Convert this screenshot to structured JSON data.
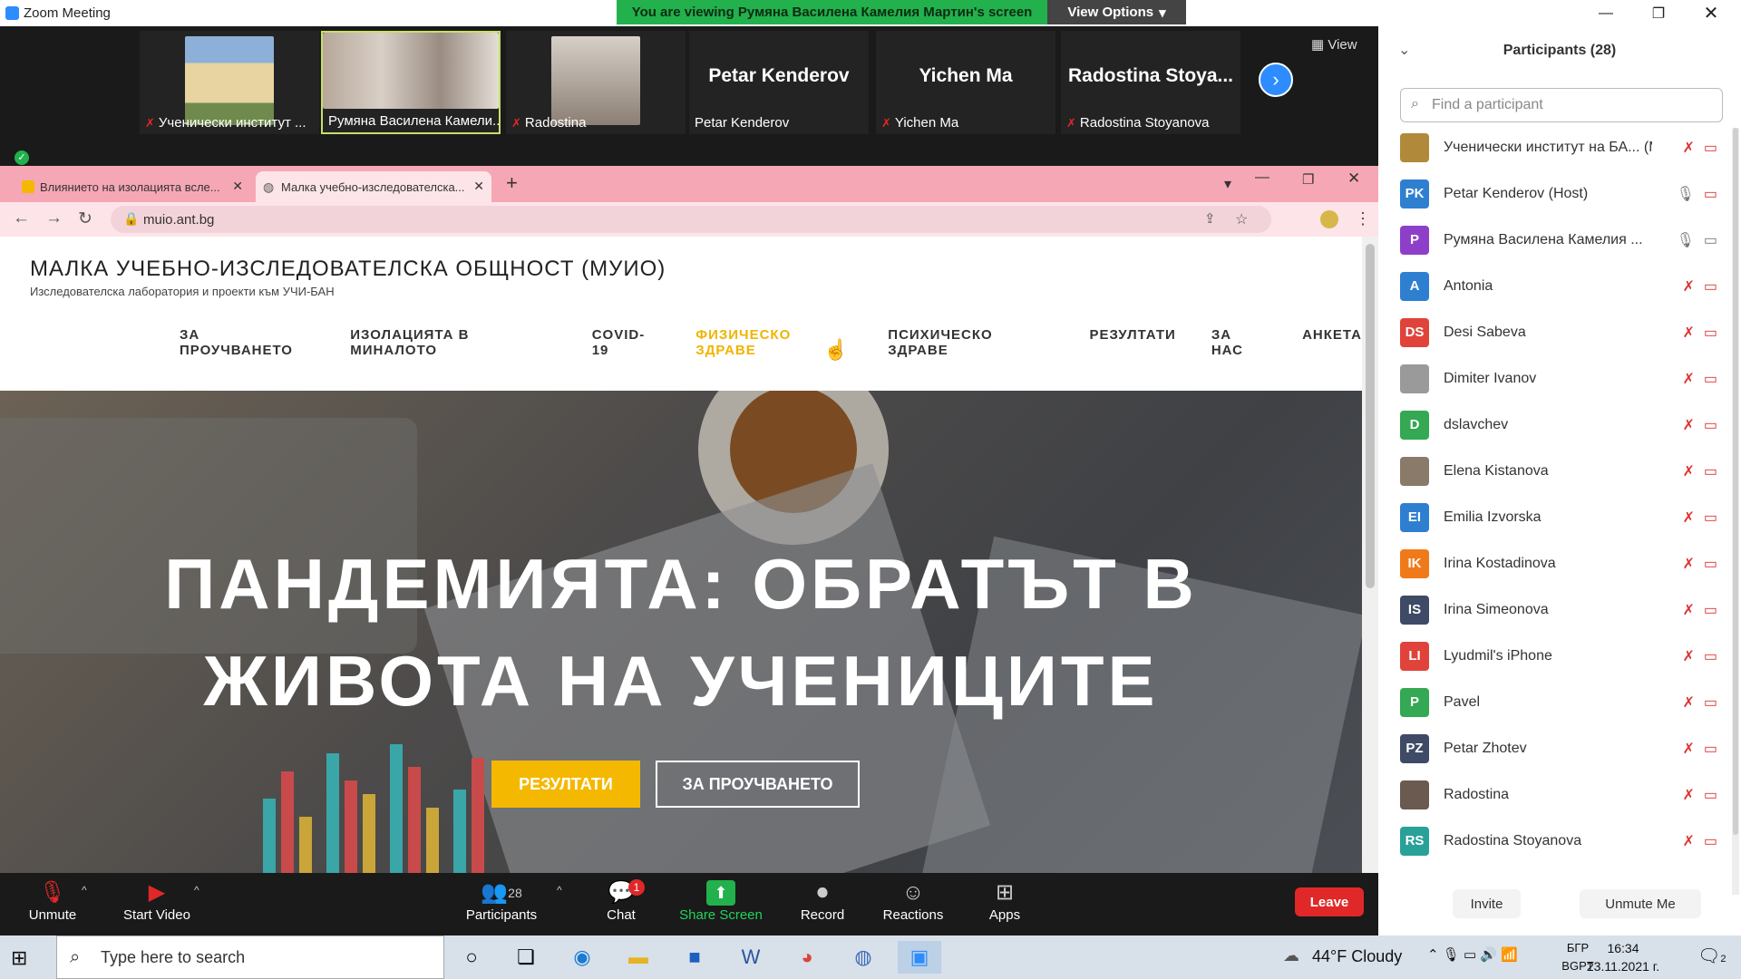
{
  "window": {
    "title": "Zoom Meeting",
    "share_banner": "You are viewing Румяна Василена Камелия Мартин's screen",
    "view_options": "View Options"
  },
  "videostrip": {
    "tiles": [
      {
        "name": "Ученически институт ...",
        "big": ""
      },
      {
        "name": "Румяна Василена Камели...",
        "big": ""
      },
      {
        "name": "Radostina",
        "big": ""
      },
      {
        "name": "Petar Kenderov",
        "big": "Petar Kenderov"
      },
      {
        "name": "Yichen Ma",
        "big": "Yichen Ma"
      },
      {
        "name": "Radostina Stoyanova",
        "big": "Radostina Stoya..."
      }
    ],
    "view_label": "View"
  },
  "browser": {
    "tabs": [
      {
        "label": "Влиянието на изолацията всле..."
      },
      {
        "label": "Малка учебно-изследователска..."
      }
    ],
    "url": "muio.ant.bg"
  },
  "site": {
    "title": "МАЛКА УЧЕБНО-ИЗСЛЕДОВАТЕЛСКА ОБЩНОСТ (МУИО)",
    "subtitle": "Изследователска лаборатория и проекти към УЧИ-БАН",
    "menu": [
      "ЗА ПРОУЧВАНЕТО",
      "ИЗОЛАЦИЯТА В МИНАЛОТО",
      "COVID-19",
      "ФИЗИЧЕСКО ЗДРАВЕ",
      "ПСИХИЧЕСКО ЗДРАВЕ",
      "РЕЗУЛТАТИ",
      "ЗА НАС",
      "АНКЕТА"
    ],
    "hero_line1": "ПАНДЕМИЯТА: ОБРАТЪТ В",
    "hero_line2": "ЖИВОТА НА УЧЕНИЦИТЕ",
    "btn_results": "РЕЗУЛТАТИ",
    "btn_about": "ЗА ПРОУЧВАНЕТО"
  },
  "participants": {
    "title": "Participants (28)",
    "search_placeholder": "Find a participant",
    "list": [
      {
        "initials": "",
        "name": "Ученически институт на БА... (Me)",
        "color": "#b08a3a"
      },
      {
        "initials": "PK",
        "name": "Petar Kenderov (Host)",
        "color": "#2f7fd1"
      },
      {
        "initials": "P",
        "name": "Румяна Василена Камелия ...",
        "color": "#8e3fc9"
      },
      {
        "initials": "A",
        "name": "Antonia",
        "color": "#2f7fd1"
      },
      {
        "initials": "DS",
        "name": "Desi Sabeva",
        "color": "#e0433a"
      },
      {
        "initials": "",
        "name": "Dimiter Ivanov",
        "color": "#9a9a9a"
      },
      {
        "initials": "D",
        "name": "dslavchev",
        "color": "#34a853"
      },
      {
        "initials": "",
        "name": "Elena Kistanova",
        "color": "#8a7a6a"
      },
      {
        "initials": "EI",
        "name": "Emilia Izvorska",
        "color": "#2f7fd1"
      },
      {
        "initials": "IK",
        "name": "Irina Kostadinova",
        "color": "#f07a1a"
      },
      {
        "initials": "IS",
        "name": "Irina Simeonova",
        "color": "#3e4a66"
      },
      {
        "initials": "LI",
        "name": "Lyudmil's iPhone",
        "color": "#e0433a"
      },
      {
        "initials": "P",
        "name": "Pavel",
        "color": "#34a853"
      },
      {
        "initials": "PZ",
        "name": "Petar Zhotev",
        "color": "#3e4a66"
      },
      {
        "initials": "",
        "name": "Radostina",
        "color": "#6a5a50"
      },
      {
        "initials": "RS",
        "name": "Radostina Stoyanova",
        "color": "#2aa198"
      }
    ],
    "invite": "Invite",
    "unmute_me": "Unmute Me"
  },
  "toolbar": {
    "unmute": "Unmute",
    "start_video": "Start Video",
    "participants": "Participants",
    "participants_count": "28",
    "chat": "Chat",
    "chat_badge": "1",
    "share_screen": "Share Screen",
    "record": "Record",
    "reactions": "Reactions",
    "apps": "Apps",
    "leave": "Leave"
  },
  "taskbar": {
    "search_placeholder": "Type here to search",
    "weather": "44°F  Cloudy",
    "lang_top": "БГР",
    "lang_bottom": "BGPT",
    "time": "16:34",
    "date": "23.11.2021 г.",
    "notif_count": "2"
  }
}
